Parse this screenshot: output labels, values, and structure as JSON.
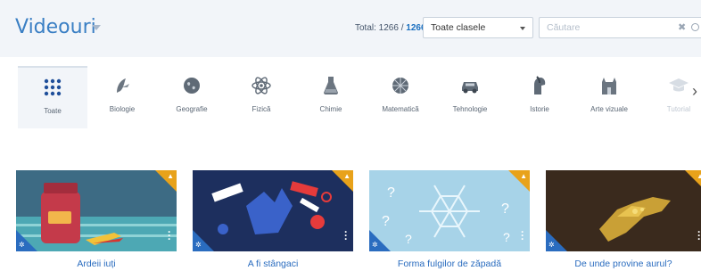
{
  "header": {
    "title": "Videouri",
    "total_prefix": "Total: 1266 / ",
    "total_count": "1266",
    "class_select": "Toate clasele",
    "search_placeholder": "Căutare",
    "search_clear": "✖"
  },
  "categories": [
    {
      "label": "Toate",
      "icon": "grid-icon",
      "active": true
    },
    {
      "label": "Biologie",
      "icon": "biology-icon"
    },
    {
      "label": "Geografie",
      "icon": "globe-icon"
    },
    {
      "label": "Fizică",
      "icon": "atom-icon"
    },
    {
      "label": "Chimie",
      "icon": "flask-icon"
    },
    {
      "label": "Matematică",
      "icon": "math-icon"
    },
    {
      "label": "Tehnologie",
      "icon": "car-icon"
    },
    {
      "label": "Istorie",
      "icon": "helmet-icon"
    },
    {
      "label": "Arte vizuale",
      "icon": "building-icon"
    },
    {
      "label": "Tutorial",
      "icon": "graduation-icon"
    }
  ],
  "videos": [
    {
      "title": "Ardeii iuți"
    },
    {
      "title": "A fi stângaci"
    },
    {
      "title": "Forma fulgilor de zăpadă"
    },
    {
      "title": "De unde provine aurul?"
    }
  ],
  "colors": {
    "accent": "#2a6cbf",
    "badge": "#e8a21a",
    "title": "#3a7fc4"
  }
}
